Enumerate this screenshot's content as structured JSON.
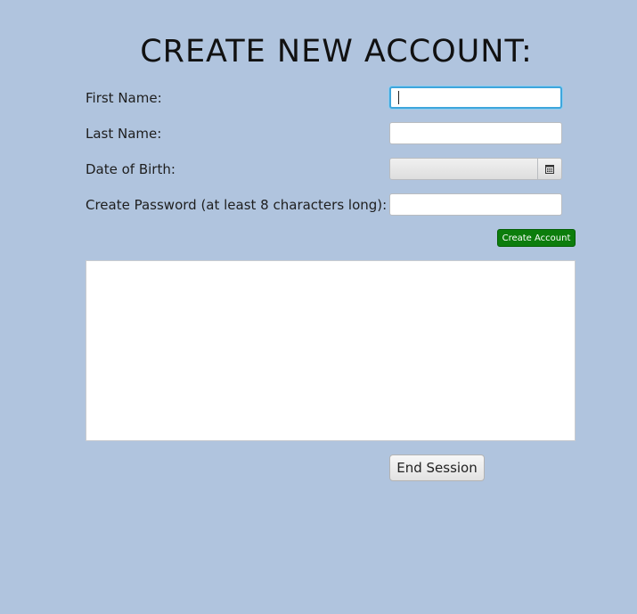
{
  "title": "CREATE NEW ACCOUNT:",
  "form": {
    "first_name_label": "First Name:",
    "first_name_value": "",
    "last_name_label": "Last Name:",
    "last_name_value": "",
    "dob_label": "Date of Birth:",
    "dob_value": "",
    "dob_button_icon": "calendar-icon",
    "password_label": "Create Password (at least 8 characters long):",
    "password_value": ""
  },
  "buttons": {
    "create_account": "Create Account",
    "end_session": "End Session"
  },
  "output_text": "",
  "colors": {
    "background": "#b0c4de",
    "create_button": "#0c7d0c",
    "focus_ring": "#3ea6dc"
  }
}
